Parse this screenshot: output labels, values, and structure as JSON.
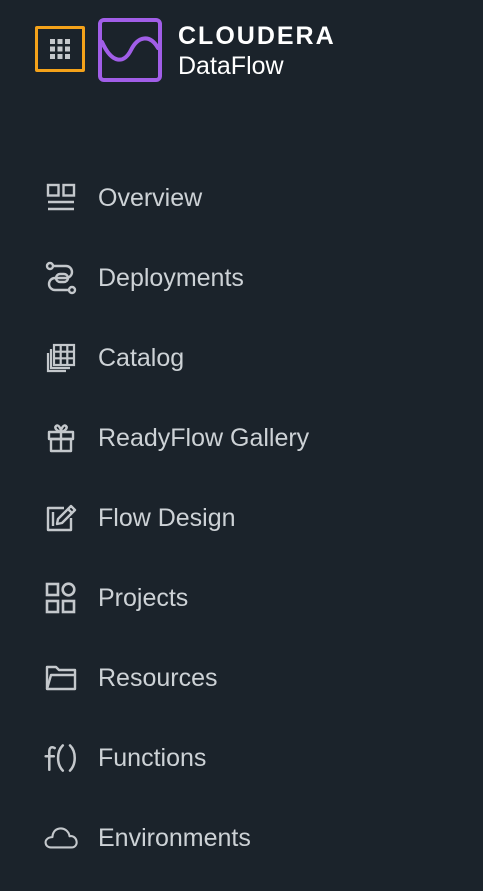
{
  "header": {
    "brand": "CLOUDERA",
    "product": "DataFlow",
    "colors": {
      "switcher_border": "#f4a21a",
      "logo_purple": "#a15ee8",
      "background": "#1b232b"
    },
    "icons": {
      "switcher": "grid-icon",
      "logo": "dataflow-logo-icon"
    }
  },
  "nav": {
    "items": [
      {
        "label": "Overview",
        "icon": "overview-icon"
      },
      {
        "label": "Deployments",
        "icon": "deployments-icon"
      },
      {
        "label": "Catalog",
        "icon": "catalog-icon"
      },
      {
        "label": "ReadyFlow Gallery",
        "icon": "gift-icon"
      },
      {
        "label": "Flow Design",
        "icon": "edit-icon"
      },
      {
        "label": "Projects",
        "icon": "projects-icon"
      },
      {
        "label": "Resources",
        "icon": "folder-icon"
      },
      {
        "label": "Functions",
        "icon": "function-icon"
      },
      {
        "label": "Environments",
        "icon": "cloud-icon"
      }
    ]
  }
}
